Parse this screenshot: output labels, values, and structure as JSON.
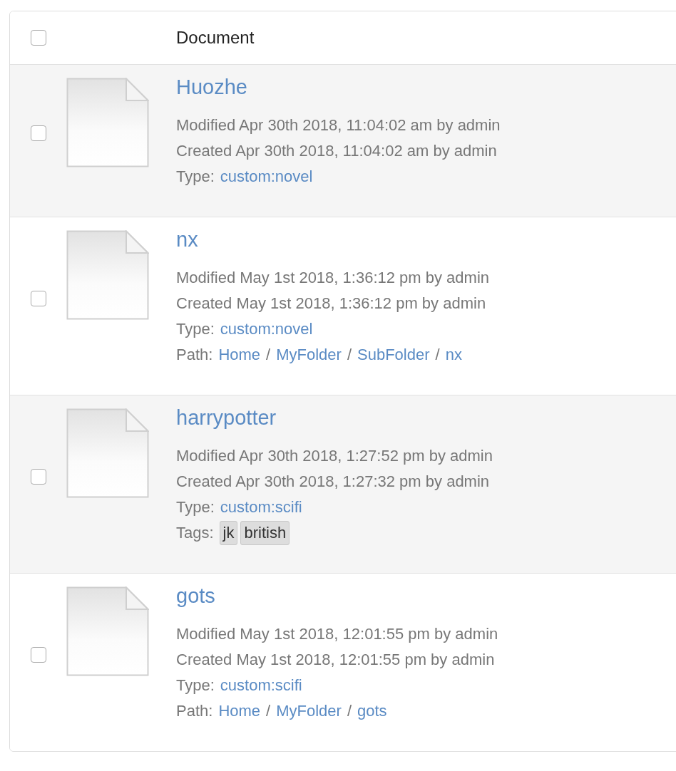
{
  "header": {
    "checked": false,
    "label": "Document"
  },
  "documents": [
    {
      "checked": false,
      "title": "Huozhe",
      "modified": "Modified Apr 30th 2018, 11:04:02 am by admin",
      "created": "Created Apr 30th 2018, 11:04:02 am by admin",
      "type": {
        "label": "Type:",
        "value": "custom:novel"
      }
    },
    {
      "checked": false,
      "title": "nx",
      "modified": "Modified May 1st 2018, 1:36:12 pm by admin",
      "created": "Created May 1st 2018, 1:36:12 pm by admin",
      "type": {
        "label": "Type:",
        "value": "custom:novel"
      },
      "path": {
        "label": "Path:",
        "parts": [
          {
            "kind": "link",
            "text": "Home"
          },
          {
            "kind": "separator",
            "text": "/"
          },
          {
            "kind": "link",
            "text": "MyFolder"
          },
          {
            "kind": "separator",
            "text": "/"
          },
          {
            "kind": "link",
            "text": "SubFolder"
          },
          {
            "kind": "separator",
            "text": "/"
          },
          {
            "kind": "link",
            "text": "nx"
          }
        ]
      }
    },
    {
      "checked": false,
      "title": "harrypotter",
      "modified": "Modified Apr 30th 2018, 1:27:52 pm by admin",
      "created": "Created Apr 30th 2018, 1:27:32 pm by admin",
      "type": {
        "label": "Type:",
        "value": "custom:scifi"
      },
      "tags": {
        "label": "Tags:",
        "items": [
          "jk",
          "british"
        ]
      }
    },
    {
      "checked": false,
      "title": "gots",
      "modified": "Modified May 1st 2018, 12:01:55 pm by admin",
      "created": "Created May 1st 2018, 12:01:55 pm by admin",
      "type": {
        "label": "Type:",
        "value": "custom:scifi"
      },
      "path": {
        "label": "Path:",
        "parts": [
          {
            "kind": "link",
            "text": "Home"
          },
          {
            "kind": "separator",
            "text": "/"
          },
          {
            "kind": "link",
            "text": "MyFolder"
          },
          {
            "kind": "separator",
            "text": "/"
          },
          {
            "kind": "link",
            "text": "gots"
          }
        ]
      }
    }
  ]
}
